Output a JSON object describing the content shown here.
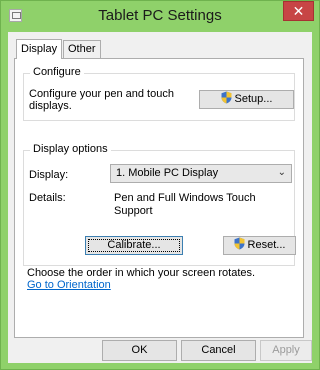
{
  "window": {
    "title": "Tablet PC Settings",
    "close_glyph": "✕"
  },
  "tabs": [
    {
      "label": "Display",
      "active": true
    },
    {
      "label": "Other",
      "active": false
    }
  ],
  "configure": {
    "group_label": "Configure",
    "description_line1": "Configure your pen and touch",
    "description_line2": "displays.",
    "setup_button": "Setup..."
  },
  "display_options": {
    "group_label": "Display options",
    "display_label": "Display:",
    "display_value": "1. Mobile PC Display",
    "details_label": "Details:",
    "details_value": "Pen and Full Windows Touch Support",
    "calibrate_button": "Calibrate...",
    "reset_button": "Reset..."
  },
  "orientation": {
    "text": "Choose the order in which your screen rotates.",
    "link": "Go to Orientation"
  },
  "footer": {
    "ok": "OK",
    "cancel": "Cancel",
    "apply": "Apply"
  },
  "colors": {
    "titlebar": "#8fd16a",
    "close": "#c74545",
    "link": "#0066cc",
    "focus": "#3c7fb1"
  },
  "icons": {
    "app": "tablet-pc-icon",
    "shield": "uac-shield-icon",
    "dropdown": "chevron-down-icon"
  }
}
